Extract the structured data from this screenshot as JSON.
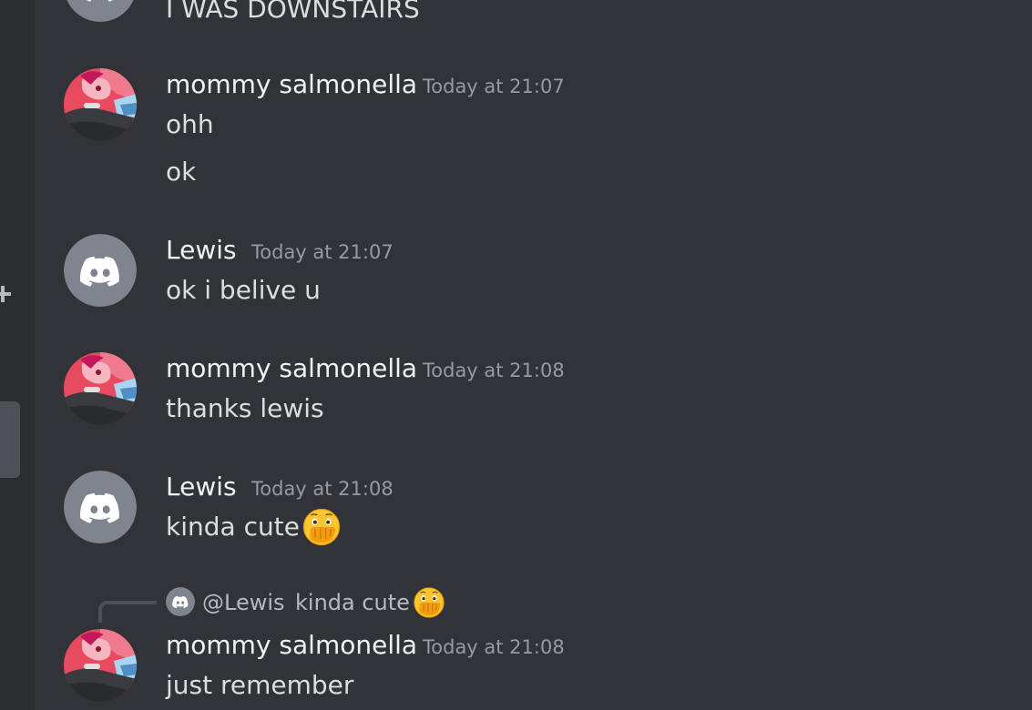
{
  "colors": {
    "background": "#313338",
    "side_strip": "#2b2d31",
    "username": "#f2f3f5",
    "timestamp": "#949ba4",
    "text": "#dbdee1",
    "default_avatar": "#80848e"
  },
  "messages": [
    {
      "text": "I WAS DOWNSTAIRS",
      "avatar": "default-discord-avatar"
    },
    {
      "author": "mommy salmonella",
      "timestamp": "Today at 21:07",
      "avatar": "salmonella-avatar",
      "lines": [
        "ohh",
        "ok"
      ]
    },
    {
      "author": "Lewis",
      "timestamp": "Today at 21:07",
      "avatar": "default-discord-avatar",
      "lines": [
        "ok i belive u"
      ]
    },
    {
      "author": "mommy salmonella",
      "timestamp": "Today at 21:08",
      "avatar": "salmonella-avatar",
      "lines": [
        "thanks lewis"
      ]
    },
    {
      "author": "Lewis",
      "timestamp": "Today at 21:08",
      "avatar": "default-discord-avatar",
      "lines": [
        "kinda cute"
      ],
      "emoji": "face-with-open-eyes-and-hand-over-mouth"
    },
    {
      "author": "mommy salmonella",
      "timestamp": "Today at 21:08",
      "avatar": "salmonella-avatar",
      "lines": [
        "just remember"
      ],
      "reply": {
        "mention": "@Lewis",
        "text": "kinda cute",
        "emoji": "face-with-open-eyes-and-hand-over-mouth"
      }
    }
  ]
}
